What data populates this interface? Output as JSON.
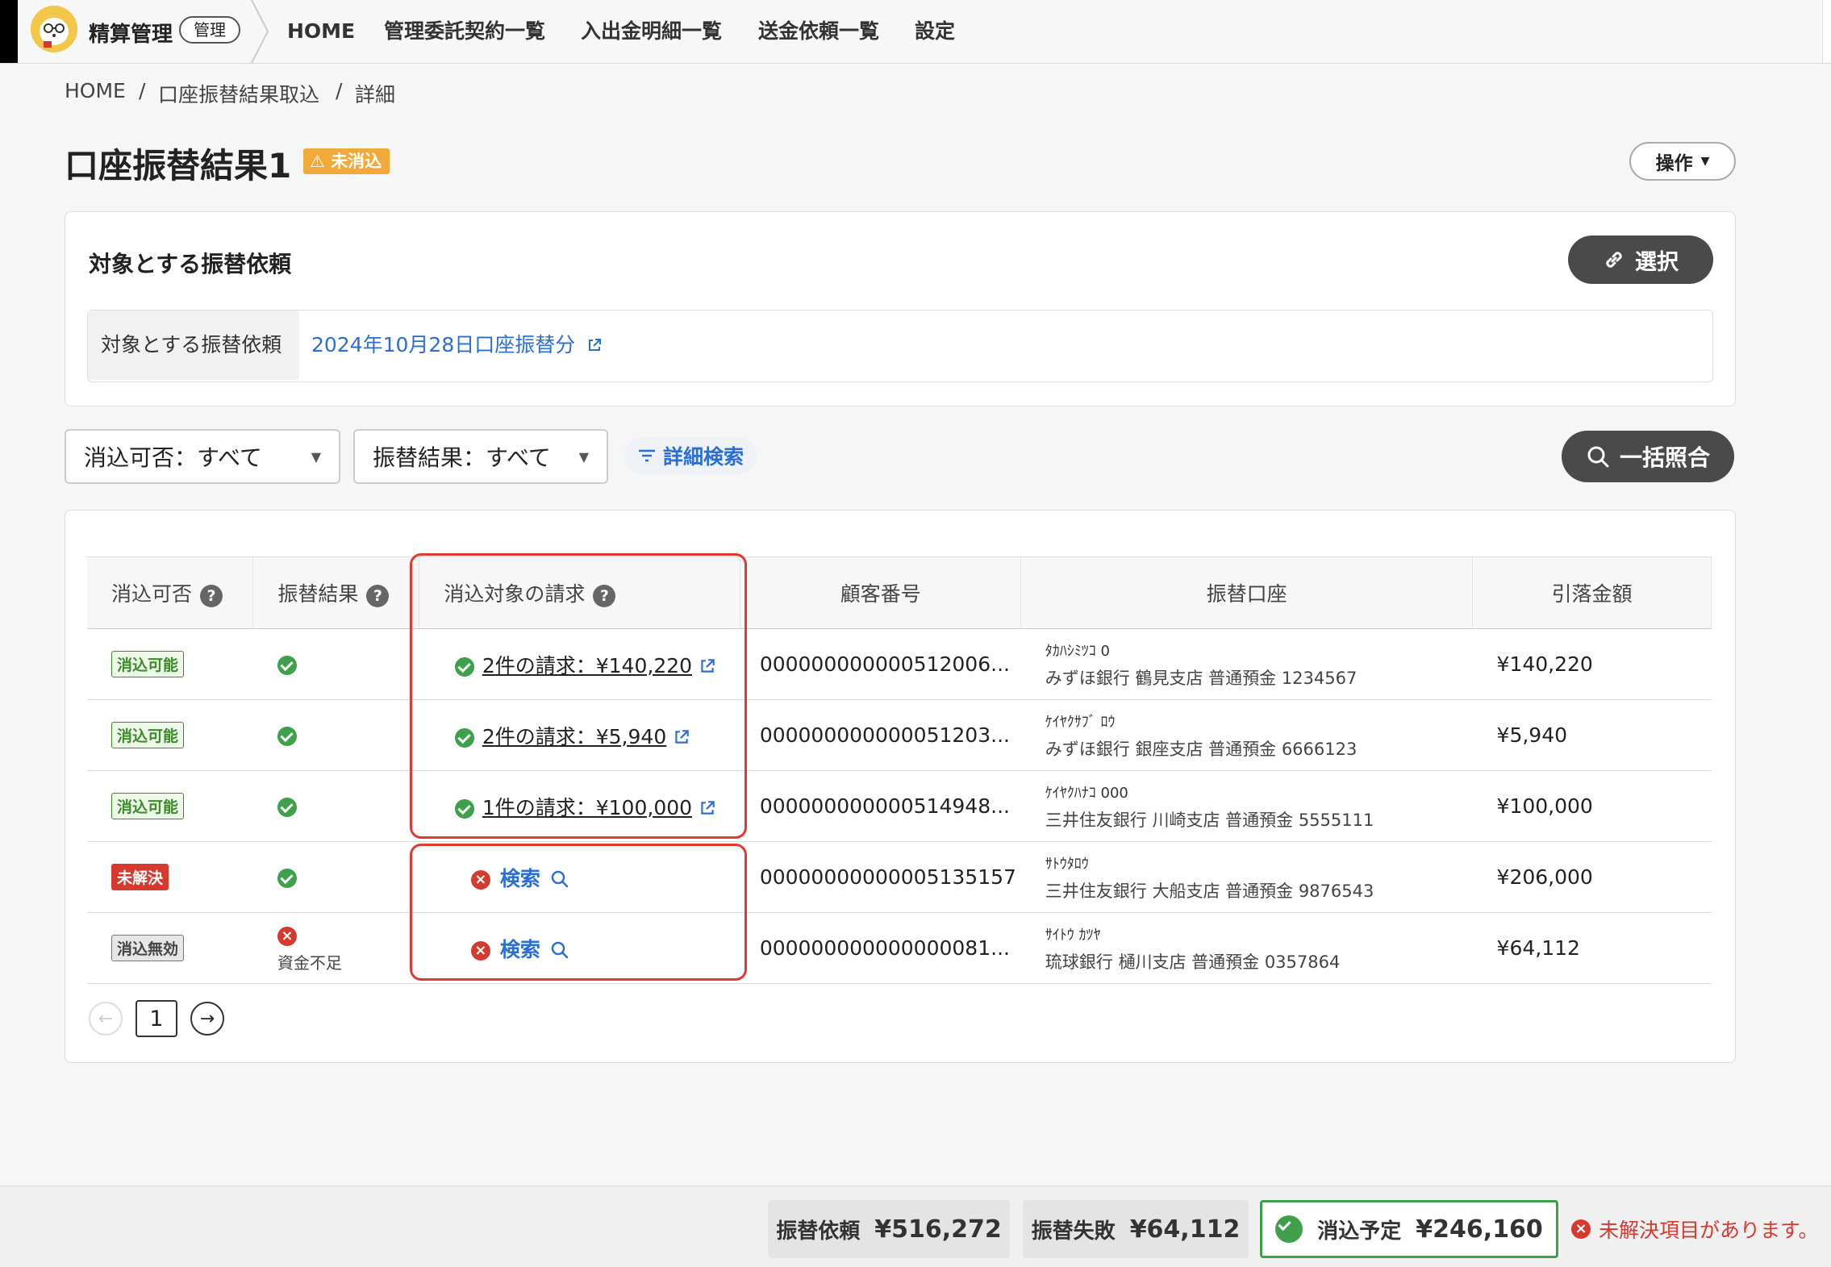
{
  "header": {
    "app_name": "精算管理",
    "admin_badge": "管理",
    "nav": [
      "HOME",
      "管理委託契約一覧",
      "入出金明細一覧",
      "送金依頼一覧",
      "設定"
    ]
  },
  "breadcrumb": [
    "HOME",
    "口座振替結果取込",
    "詳細"
  ],
  "page": {
    "title": "口座振替結果1",
    "status_badge": "未消込",
    "ops_label": "操作"
  },
  "target": {
    "title": "対象とする振替依頼",
    "select_label": "選択",
    "field_label": "対象とする振替依頼",
    "field_value": "2024年10月28日口座振替分"
  },
  "filters": {
    "reconcile": "消込可否：すべて",
    "result": "振替結果：すべて",
    "advanced": "詳細検索",
    "bulk": "一括照合"
  },
  "table": {
    "headers": [
      "消込可否",
      "振替結果",
      "消込対象の請求",
      "顧客番号",
      "振替口座",
      "引落金額"
    ],
    "rows": [
      {
        "status": "消込可能",
        "status_kind": "ok",
        "result": "ok",
        "result_note": "",
        "invoice": "2件の請求：¥140,220",
        "customer": "000000000000512006...",
        "kana": "ﾀｶﾊｼﾐﾂｺ 0",
        "account": "みずほ銀行 鶴見支店 普通預金 1234567",
        "amount": "¥140,220"
      },
      {
        "status": "消込可能",
        "status_kind": "ok",
        "result": "ok",
        "result_note": "",
        "invoice": "2件の請求：¥5,940",
        "customer": "000000000000051203...",
        "kana": "ｹｲﾔｸｻﾌﾞ ﾛｳ",
        "account": "みずほ銀行 銀座支店 普通預金 6666123",
        "amount": "¥5,940"
      },
      {
        "status": "消込可能",
        "status_kind": "ok",
        "result": "ok",
        "result_note": "",
        "invoice": "1件の請求：¥100,000",
        "customer": "000000000000514948...",
        "kana": "ｹｲﾔｸﾊﾅｺ 000",
        "account": "三井住友銀行 川崎支店 普通預金 5555111",
        "amount": "¥100,000"
      },
      {
        "status": "未解決",
        "status_kind": "ng",
        "result": "ok",
        "result_note": "",
        "invoice": "検索",
        "customer": "00000000000005135157",
        "kana": "ｻﾄｳﾀﾛｳ",
        "account": "三井住友銀行 大船支店 普通預金 9876543",
        "amount": "¥206,000"
      },
      {
        "status": "消込無効",
        "status_kind": "void",
        "result": "ng",
        "result_note": "資金不足",
        "invoice": "検索",
        "customer": "000000000000000081...",
        "kana": "ｻｲﾄｳ ｶﾂﾔ",
        "account": "琉球銀行 樋川支店 普通預金 0357864",
        "amount": "¥64,112"
      }
    ]
  },
  "pager": {
    "current": "1"
  },
  "footer": {
    "request_label": "振替依頼",
    "request_amount": "¥516,272",
    "fail_label": "振替失敗",
    "fail_amount": "¥64,112",
    "planned_label": "消込予定",
    "planned_amount": "¥246,160",
    "error": "未解決項目があります。"
  },
  "colors": {
    "accent_link": "#2a6fd6",
    "ok": "#3fa04b",
    "error": "#d63a2f",
    "warn": "#f1a93a"
  }
}
